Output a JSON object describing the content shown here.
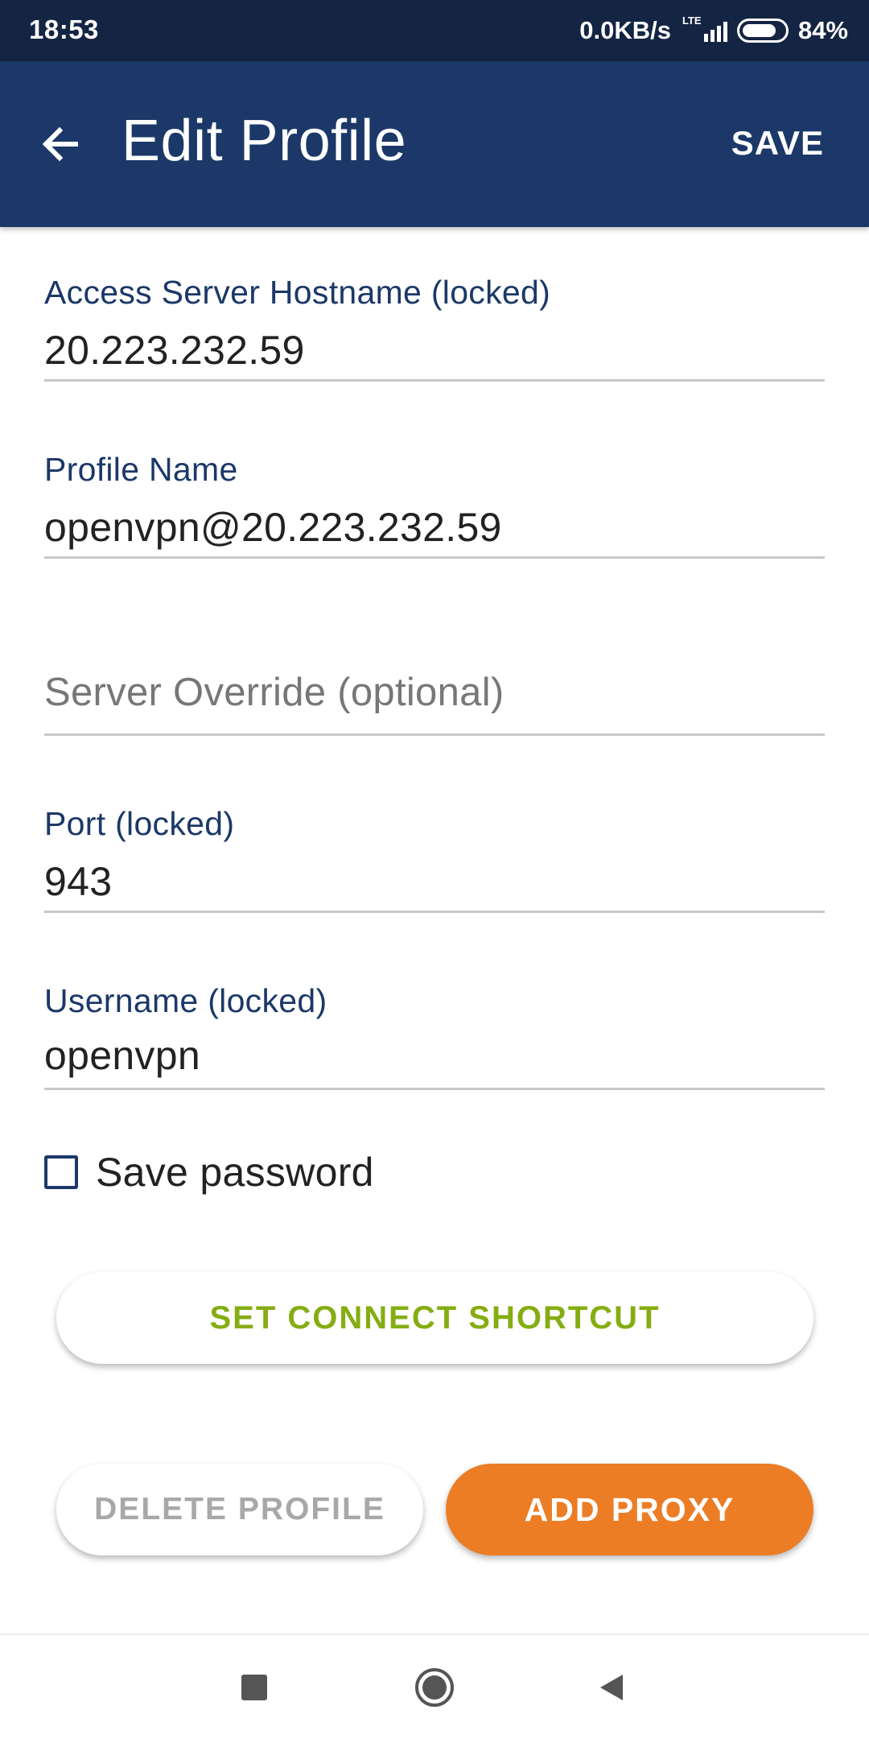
{
  "status_bar": {
    "time": "18:53",
    "network_speed": "0.0KB/s",
    "network_type": "LTE",
    "battery": "84%",
    "battery_level": 0.84
  },
  "app_bar": {
    "title": "Edit Profile",
    "save_label": "SAVE",
    "back_icon": "arrow-back-icon"
  },
  "form": {
    "hostname": {
      "label": "Access Server Hostname (locked)",
      "value": "20.223.232.59"
    },
    "profile_name": {
      "label": "Profile Name",
      "value": "openvpn@20.223.232.59"
    },
    "server_override": {
      "placeholder": "Server Override (optional)"
    },
    "port": {
      "label": "Port (locked)",
      "value": "943"
    },
    "username": {
      "label": "Username (locked)",
      "value": "openvpn"
    },
    "save_password": {
      "label": "Save password",
      "checked": false
    }
  },
  "buttons": {
    "connect_shortcut": "SET CONNECT SHORTCUT",
    "delete_profile": "DELETE PROFILE",
    "add_proxy": "ADD PROXY"
  },
  "colors": {
    "status_bar": "#142443",
    "app_bar": "#1b3868",
    "label": "#1b3868",
    "connect_shortcut_text": "#85ad12",
    "add_proxy_bg": "#ec7d25",
    "delete_text": "#a8a8a8"
  },
  "nav_bar": {
    "icons": [
      "recent-apps-icon",
      "home-icon",
      "back-icon"
    ]
  }
}
